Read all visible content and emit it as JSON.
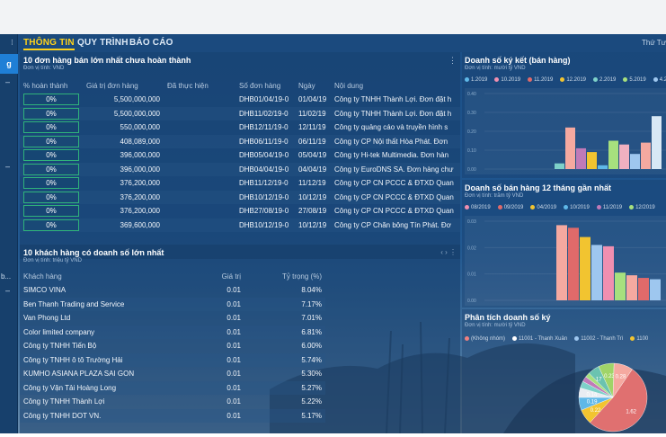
{
  "nav": {
    "tabs": [
      "THÔNG TIN",
      "QUY TRÌNH",
      "BÁO CÁO"
    ],
    "right_text": "Thứ Tư"
  },
  "sidebar": {
    "active_label": "g",
    "dash": "–",
    "bottom_text": "b..."
  },
  "orders": {
    "title": "10 đơn hàng bán lớn nhất chưa hoàn thành",
    "subtitle": "Đơn vị tính: VND",
    "menu": "⋮",
    "columns": [
      "% hoàn thành",
      "Giá trị đơn hàng",
      "Đã thực hiện",
      "Số đơn hàng",
      "Ngày",
      "Nội dung"
    ],
    "rows": [
      {
        "pct": "0%",
        "value": "5,500,000,000",
        "done": "",
        "code": "DHB01/04/19-0",
        "date": "01/04/19",
        "content": "Công ty TNHH Thành Lợi. Đơn đặt h"
      },
      {
        "pct": "0%",
        "value": "5,500,000,000",
        "done": "",
        "code": "DHB11/02/19-0",
        "date": "11/02/19",
        "content": "Công ty TNHH Thành Lợi. Đơn đặt h"
      },
      {
        "pct": "0%",
        "value": "550,000,000",
        "done": "",
        "code": "DHB12/11/19-0",
        "date": "12/11/19",
        "content": "Công ty quảng cáo và truyền hình s"
      },
      {
        "pct": "0%",
        "value": "408,089,000",
        "done": "",
        "code": "DHB06/11/19-0",
        "date": "06/11/19",
        "content": "Công ty CP Nội thất Hòa Phát. Đơn"
      },
      {
        "pct": "0%",
        "value": "396,000,000",
        "done": "",
        "code": "DHB05/04/19-0",
        "date": "05/04/19",
        "content": "Công ty Hi-tek Multimedia. Đơn hàn"
      },
      {
        "pct": "0%",
        "value": "396,000,000",
        "done": "",
        "code": "DHB04/04/19-0",
        "date": "04/04/19",
        "content": "Công ty EuroDNS SA. Đơn hàng chư"
      },
      {
        "pct": "0%",
        "value": "376,200,000",
        "done": "",
        "code": "DHB11/12/19-0",
        "date": "11/12/19",
        "content": "Công ty CP CN PCCC & ĐTXD Quan"
      },
      {
        "pct": "0%",
        "value": "376,200,000",
        "done": "",
        "code": "DHB10/12/19-0",
        "date": "10/12/19",
        "content": "Công ty CP CN PCCC & ĐTXD Quan"
      },
      {
        "pct": "0%",
        "value": "376,200,000",
        "done": "",
        "code": "DHB27/08/19-0",
        "date": "27/08/19",
        "content": "Công ty CP CN PCCC & ĐTXD Quan"
      },
      {
        "pct": "0%",
        "value": "369,600,000",
        "done": "",
        "code": "DHB10/12/19-0",
        "date": "10/12/19",
        "content": "Công ty CP Chăn bông Tín Phát. Đơ"
      }
    ]
  },
  "customers": {
    "title": "10 khách hàng có doanh số lớn nhất",
    "subtitle": "Đơn vị tính: triệu tỷ VND",
    "pager": "‹ › ⋮",
    "columns": [
      "Khách hàng",
      "Giá trị",
      "Tỷ trọng (%)"
    ],
    "rows": [
      {
        "name": "SIMCO VINA",
        "value": "0.01",
        "share": "8.04%"
      },
      {
        "name": "Ben Thanh Trading and Service",
        "value": "0.01",
        "share": "7.17%"
      },
      {
        "name": "Van Phong Ltd",
        "value": "0.01",
        "share": "7.01%"
      },
      {
        "name": "Color limited company",
        "value": "0.01",
        "share": "6.81%"
      },
      {
        "name": "Công ty TNHH Tiến Bộ",
        "value": "0.01",
        "share": "6.00%"
      },
      {
        "name": "Công ty TNHH ô tô Trường Hải",
        "value": "0.01",
        "share": "5.74%"
      },
      {
        "name": "KUMHO ASIANA PLAZA SAI GON",
        "value": "0.01",
        "share": "5.30%"
      },
      {
        "name": "Công ty Vận Tải Hoàng Long",
        "value": "0.01",
        "share": "5.27%"
      },
      {
        "name": "Công ty TNHH Thành Lợi",
        "value": "0.01",
        "share": "5.22%"
      },
      {
        "name": "Công ty TNHH DOT VN.",
        "value": "0.01",
        "share": "5.17%"
      }
    ]
  },
  "chart_data": [
    {
      "type": "bar",
      "title": "Doanh số ký kết (bán hàng)",
      "subtitle": "Đơn vị tính: mười tỷ VND",
      "ylim": [
        0,
        0.4
      ],
      "yticks": [
        "0.40",
        "0.30",
        "0.20",
        "0.10",
        "0.00"
      ],
      "legend_position": "top",
      "series": [
        {
          "name": "1.2019",
          "color": "#5fb8e8",
          "values": [
            0.0
          ]
        },
        {
          "name": "10.2019",
          "color": "#f08fb0",
          "values": [
            0.0
          ]
        },
        {
          "name": "11.2019",
          "color": "#e06a6a",
          "values": [
            0.0
          ]
        },
        {
          "name": "12.2019",
          "color": "#f2c430",
          "values": [
            0.0
          ]
        },
        {
          "name": "2.2019",
          "color": "#7ed1c9",
          "values": [
            0.0
          ]
        },
        {
          "name": "5.2019",
          "color": "#a7e07e",
          "values": [
            0.0
          ]
        },
        {
          "name": "4.20",
          "color": "#9ec7ef",
          "values": [
            0.0
          ]
        }
      ],
      "bars": [
        {
          "value": 0.03,
          "color": "#7ed1c9"
        },
        {
          "value": 0.22,
          "color": "#f5a9a0"
        },
        {
          "value": 0.11,
          "color": "#c07ab8"
        },
        {
          "value": 0.09,
          "color": "#f2c430"
        },
        {
          "value": 0.02,
          "color": "#5fb8e8"
        },
        {
          "value": 0.15,
          "color": "#a7e07e"
        },
        {
          "value": 0.13,
          "color": "#f0b0c0"
        },
        {
          "value": 0.08,
          "color": "#9ec7ef"
        },
        {
          "value": 0.14,
          "color": "#f5a9a0"
        },
        {
          "value": 0.28,
          "color": "#d8e8f5"
        }
      ]
    },
    {
      "type": "bar",
      "title": "Doanh số bán hàng 12 tháng gần nhất",
      "subtitle": "Đơn vị tính: trăm tỷ VND",
      "ylim": [
        0,
        0.03
      ],
      "yticks": [
        "0.03",
        "0.02",
        "0.01",
        "0.00"
      ],
      "legend_position": "top",
      "series": [
        {
          "name": "08/2019",
          "color": "#f08fb0"
        },
        {
          "name": "09/2019",
          "color": "#e06a6a"
        },
        {
          "name": "04/2019",
          "color": "#f2c430"
        },
        {
          "name": "10/2019",
          "color": "#5fb8e8"
        },
        {
          "name": "11/2019",
          "color": "#c07ab8"
        },
        {
          "name": "12/2019",
          "color": "#a7e07e"
        }
      ],
      "bars": [
        {
          "value": 0.0285,
          "color": "#f5a9a0"
        },
        {
          "value": 0.0275,
          "color": "#e06a6a"
        },
        {
          "value": 0.024,
          "color": "#f2c430"
        },
        {
          "value": 0.021,
          "color": "#9ec7ef"
        },
        {
          "value": 0.0205,
          "color": "#f08fb0"
        },
        {
          "value": 0.0105,
          "color": "#a7e07e"
        },
        {
          "value": 0.0095,
          "color": "#f5a9a0"
        },
        {
          "value": 0.0085,
          "color": "#e06a6a"
        },
        {
          "value": 0.008,
          "color": "#9ec7ef"
        }
      ]
    },
    {
      "type": "pie",
      "title": "Phân tích doanh số ký",
      "subtitle": "Đơn vị tính: mười tỷ VND",
      "legend_position": "top",
      "legend": [
        {
          "name": "(Không nhóm)",
          "color": "#f08080"
        },
        {
          "name": "11001 - Thanh Xuân",
          "color": "#ffffff"
        },
        {
          "name": "11002 - Thanh Trì",
          "color": "#9ec7ef"
        },
        {
          "name": "1100",
          "color": "#f2c430"
        }
      ],
      "slices": [
        {
          "value": 1.62,
          "label": "1.62",
          "color": "#e07070"
        },
        {
          "value": 0.22,
          "label": "0.22",
          "color": "#f2c430"
        },
        {
          "value": 0.19,
          "label": "0.19",
          "color": "#5fb8e8"
        },
        {
          "value": 0.14,
          "label": "0.14",
          "color": "#e8ecf2"
        },
        {
          "value": 0.1,
          "label": "",
          "color": "#7ed1c9"
        },
        {
          "value": 0.08,
          "label": "",
          "color": "#c07ab8"
        },
        {
          "value": 0.07,
          "label": "",
          "color": "#a7e07e"
        },
        {
          "value": 0.17,
          "label": "17",
          "color": "#6bc3b0"
        },
        {
          "value": 0.23,
          "label": "0.23",
          "color": "#a0d468"
        },
        {
          "value": 0.28,
          "label": "0.28",
          "color": "#f5a9a0"
        }
      ]
    }
  ]
}
